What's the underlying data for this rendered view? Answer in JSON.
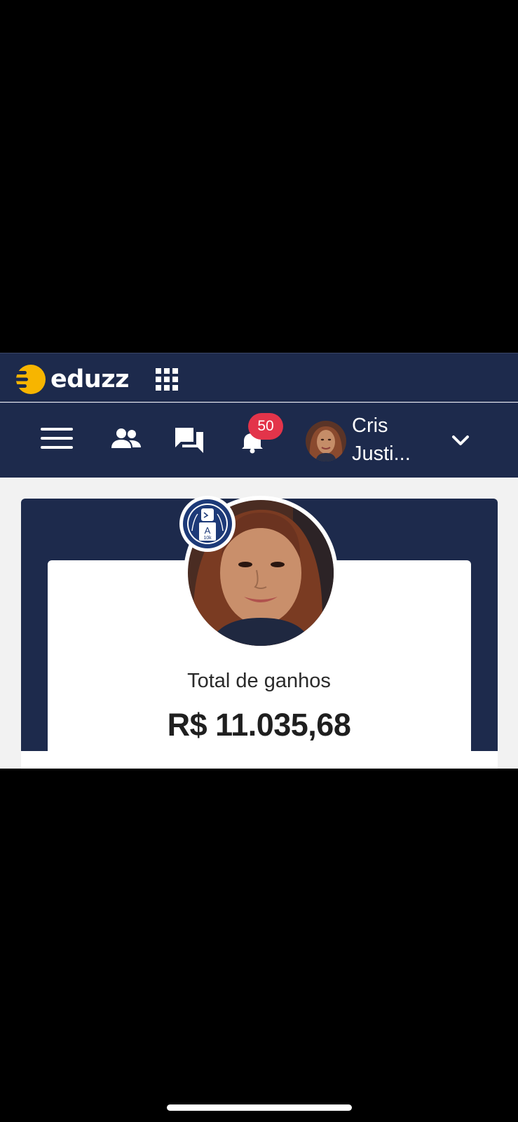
{
  "brand": {
    "name": "eduzz",
    "accent_color": "#f7b500",
    "nav_color": "#1d2a4c"
  },
  "topbar": {
    "logo_icon": "eduzz-logo-icon",
    "apps_icon": "apps-grid-icon"
  },
  "navbar": {
    "menu_icon": "hamburger-menu-icon",
    "people_icon": "people-icon",
    "chat_icon": "chat-icon",
    "bell_icon": "bell-icon",
    "notification_count": "50",
    "user_name": "Cris Justi...",
    "dropdown_icon": "chevron-down-icon"
  },
  "profile": {
    "achievement_badge_text": "10k",
    "achievement_letter": "A",
    "earnings_label": "Total de ganhos",
    "earnings_value": "R$ 11.035,68"
  }
}
